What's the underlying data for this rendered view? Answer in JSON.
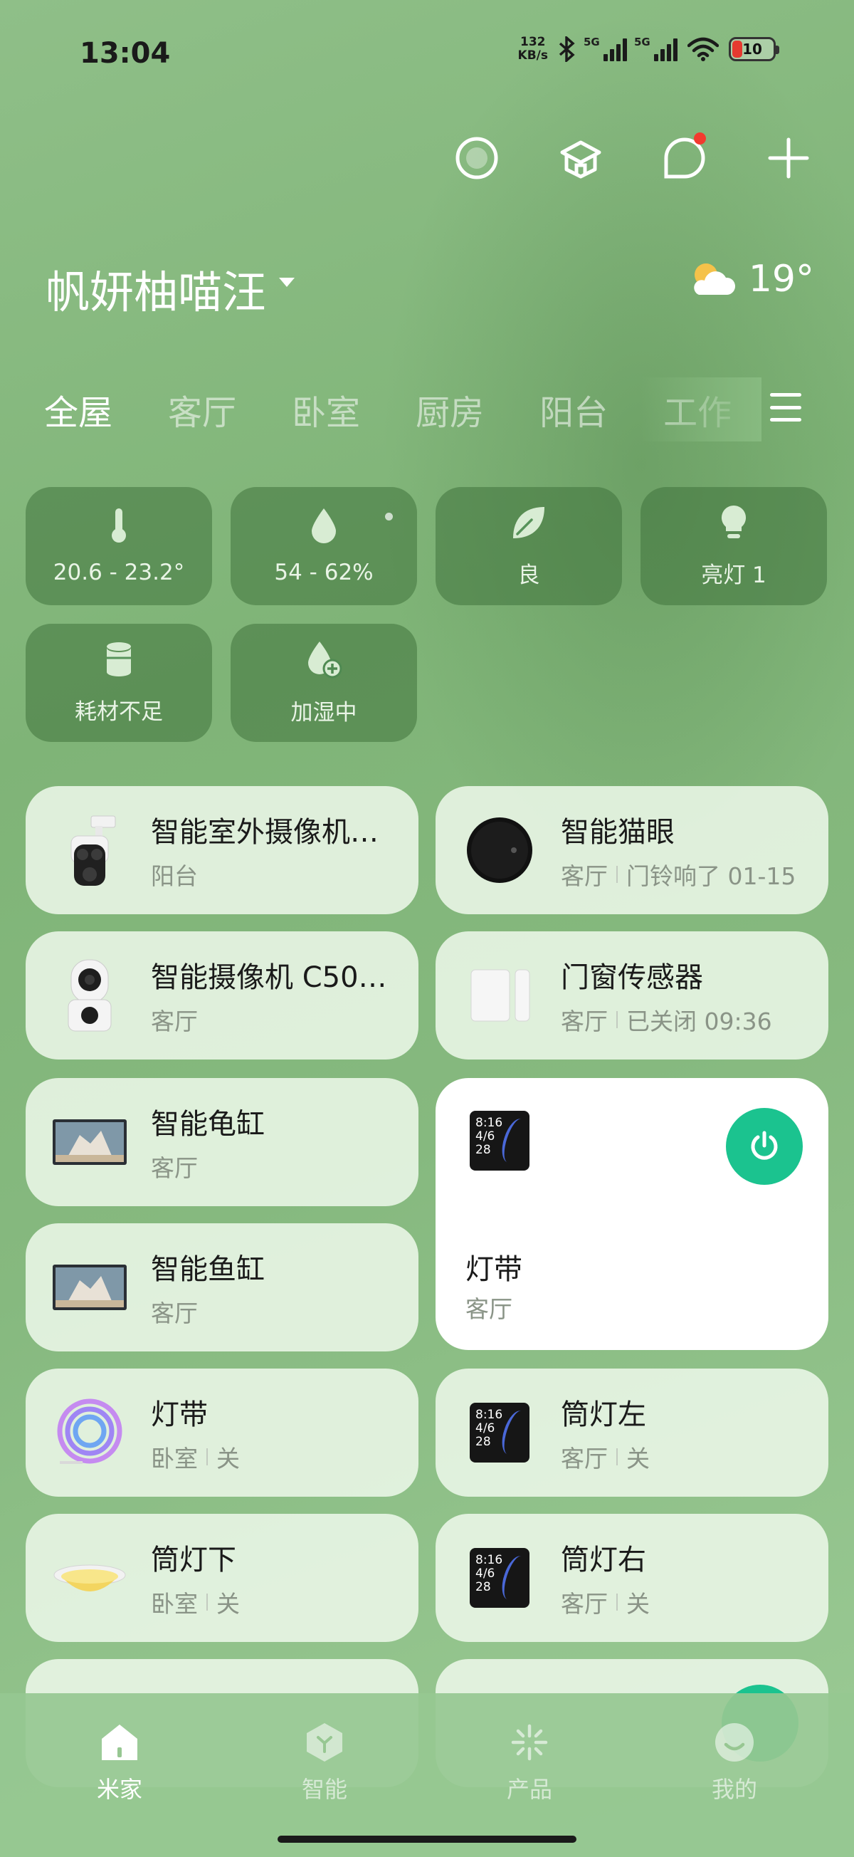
{
  "status_bar": {
    "time": "13:04",
    "net_speed_value": "132",
    "net_speed_unit": "KB/s",
    "sim1": "5G",
    "sim2": "5G",
    "battery": "10",
    "battery_color": "#e53a30"
  },
  "top_actions": [
    "circle-icon",
    "house-cube-icon",
    "chat-bubble-icon",
    "plus-icon"
  ],
  "home": {
    "name": "帆妍柚喵汪",
    "weather_temp": "19°",
    "weather_icon": "partly-cloudy-icon"
  },
  "tabs": [
    {
      "label": "全屋",
      "active": true
    },
    {
      "label": "客厅"
    },
    {
      "label": "卧室"
    },
    {
      "label": "厨房"
    },
    {
      "label": "阳台"
    },
    {
      "label": "工作"
    }
  ],
  "stats": [
    {
      "icon": "thermometer-icon",
      "label": "20.6 - 23.2°"
    },
    {
      "icon": "droplet-icon",
      "label": "54 - 62%"
    },
    {
      "icon": "leaf-icon",
      "label": "良"
    },
    {
      "icon": "bulb-icon",
      "label": "亮灯 1"
    },
    {
      "icon": "filter-icon",
      "label": "耗材不足"
    },
    {
      "icon": "humidify-icon",
      "label": "加湿中"
    }
  ],
  "devices": [
    {
      "name": "智能室外摄像机…",
      "room": "阳台"
    },
    {
      "name": "智能猫眼",
      "room": "客厅",
      "status": "门铃响了 01-15"
    },
    {
      "name": "智能摄像机 C50…",
      "room": "客厅"
    },
    {
      "name": "门窗传感器",
      "room": "客厅",
      "status": "已关闭 09:36"
    },
    {
      "name": "智能龟缸",
      "room": "客厅"
    },
    {
      "name": "灯带",
      "room": "客厅",
      "panel_text": "8:16\n4/6\n28"
    },
    {
      "name": "智能鱼缸",
      "room": "客厅"
    },
    {
      "name": "灯带",
      "room": "卧室",
      "status": "关"
    },
    {
      "name": "筒灯左",
      "room": "客厅",
      "status": "关",
      "panel_text": "8:16\n4/6\n28"
    },
    {
      "name": "筒灯下",
      "room": "卧室",
      "status": "关"
    },
    {
      "name": "筒灯右",
      "room": "客厅",
      "status": "关",
      "panel_text": "8:16\n4/6\n28"
    }
  ],
  "accent_color": "#1bc38f",
  "bottom_nav": [
    {
      "label": "米家",
      "active": true
    },
    {
      "label": "智能"
    },
    {
      "label": "产品"
    },
    {
      "label": "我的"
    }
  ]
}
